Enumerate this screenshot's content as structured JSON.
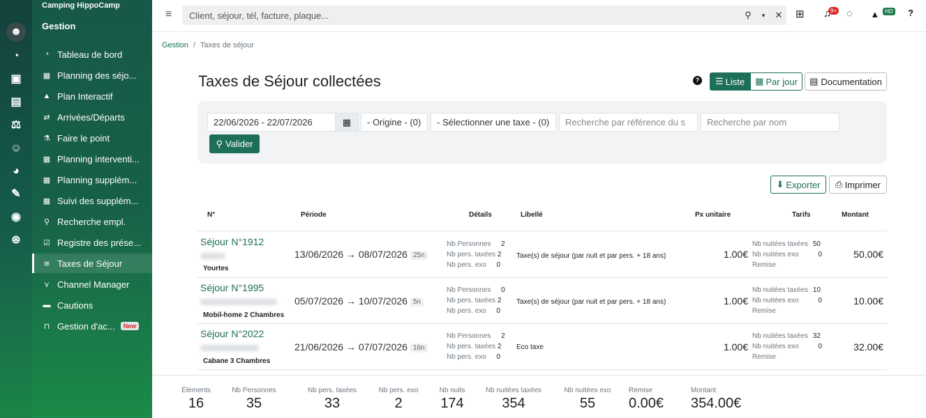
{
  "sidebar": {
    "camping": "Camping HippoCamp",
    "section": "Gestion",
    "items": [
      {
        "label": "Tableau de bord",
        "icon": "gauge-icon"
      },
      {
        "label": "Planning des séjo...",
        "icon": "calendar-icon"
      },
      {
        "label": "Plan Interactif",
        "icon": "map-icon"
      },
      {
        "label": "Arrivées/Départs",
        "icon": "arrows-icon"
      },
      {
        "label": "Faire le point",
        "icon": "flask-icon"
      },
      {
        "label": "Planning interventi...",
        "icon": "calendar-icon"
      },
      {
        "label": "Planning supplém...",
        "icon": "calendar-icon"
      },
      {
        "label": "Suivi des supplém...",
        "icon": "calendar-icon"
      },
      {
        "label": "Recherche empl.",
        "icon": "search-icon"
      },
      {
        "label": "Registre des prése...",
        "icon": "checkbox-icon"
      },
      {
        "label": "Taxes de Séjour",
        "icon": "money-icon"
      },
      {
        "label": "Channel Manager",
        "icon": "antenna-icon"
      },
      {
        "label": "Cautions",
        "icon": "cash-icon"
      },
      {
        "label": "Gestion d'ac...",
        "icon": "barrier-icon",
        "badge": "New"
      }
    ]
  },
  "topbar": {
    "search_placeholder": "Client, séjour, tél, facture, plaque...",
    "notif_count": "9+",
    "user_initials": "HD"
  },
  "breadcrumb": {
    "root": "Gestion",
    "sep": "/",
    "current": "Taxes de séjour"
  },
  "page": {
    "title": "Taxes de Séjour collectées",
    "btn_list": "Liste",
    "btn_day": "Par jour",
    "btn_doc": "Documentation",
    "btn_export": "Exporter",
    "btn_print": "Imprimer"
  },
  "filters": {
    "date_range": "22/06/2026 - 22/07/2026",
    "origin": "- Origine - (0)",
    "tax": "- Sélectionner une taxe - (0)",
    "ref_placeholder": "Recherche par référence du s",
    "name_placeholder": "Recherche par nom",
    "submit": "Valider"
  },
  "table": {
    "headers": {
      "num": "N°",
      "period": "Période",
      "details": "Détails",
      "label": "Libellé",
      "unit": "Px unitaire",
      "rates": "Tarifs",
      "amount": "Montant"
    },
    "detail_labels": {
      "persons": "Nb Personnes",
      "taxed": "Nb pers. taxées",
      "exempt": "Nb pers. exo"
    },
    "rate_labels": {
      "taxed_nights": "Nb nuitées taxées",
      "exempt_nights": "Nb nuitées exo",
      "discount": "Remise"
    },
    "rows": [
      {
        "sejour": "Séjour N°1912",
        "type": "Yourtes",
        "from": "13/06/2026",
        "to": "08/07/2026",
        "nights": "25n",
        "persons": "2",
        "taxed": "2",
        "exempt": "0",
        "label": "Taxe(s) de séjour (par nuit et par pers. + 18 ans)",
        "unit": "1.00€",
        "taxed_nights": "50",
        "exempt_nights": "0",
        "amount": "50.00€"
      },
      {
        "sejour": "Séjour N°1995",
        "type": "Mobil-home 2 Chambres",
        "from": "05/07/2026",
        "to": "10/07/2026",
        "nights": "5n",
        "persons": "0",
        "taxed": "2",
        "exempt": "0",
        "label": "Taxe(s) de séjour (par nuit et par pers. + 18 ans)",
        "unit": "1.00€",
        "taxed_nights": "10",
        "exempt_nights": "0",
        "amount": "10.00€"
      },
      {
        "sejour": "Séjour N°2022",
        "type": "Cabane 3 Chambres",
        "from": "21/06/2026",
        "to": "07/07/2026",
        "nights": "16n",
        "persons": "2",
        "taxed": "2",
        "exempt": "0",
        "label": "Eco taxe",
        "unit": "1.00€",
        "taxed_nights": "32",
        "exempt_nights": "0",
        "amount": "32.00€"
      }
    ]
  },
  "totals": [
    {
      "label": "Éléments",
      "value": "16"
    },
    {
      "label": "Nb Personnes",
      "value": "35"
    },
    {
      "label": "Nb pers. taxées",
      "value": "33"
    },
    {
      "label": "Nb pers. exo",
      "value": "2"
    },
    {
      "label": "Nb nuits",
      "value": "174"
    },
    {
      "label": "Nb nuitées taxées",
      "value": "354"
    },
    {
      "label": "Nb nuitées exo",
      "value": "55"
    },
    {
      "label": "Remise",
      "value": "0.00€"
    },
    {
      "label": "Montant",
      "value": "354.00€"
    }
  ]
}
